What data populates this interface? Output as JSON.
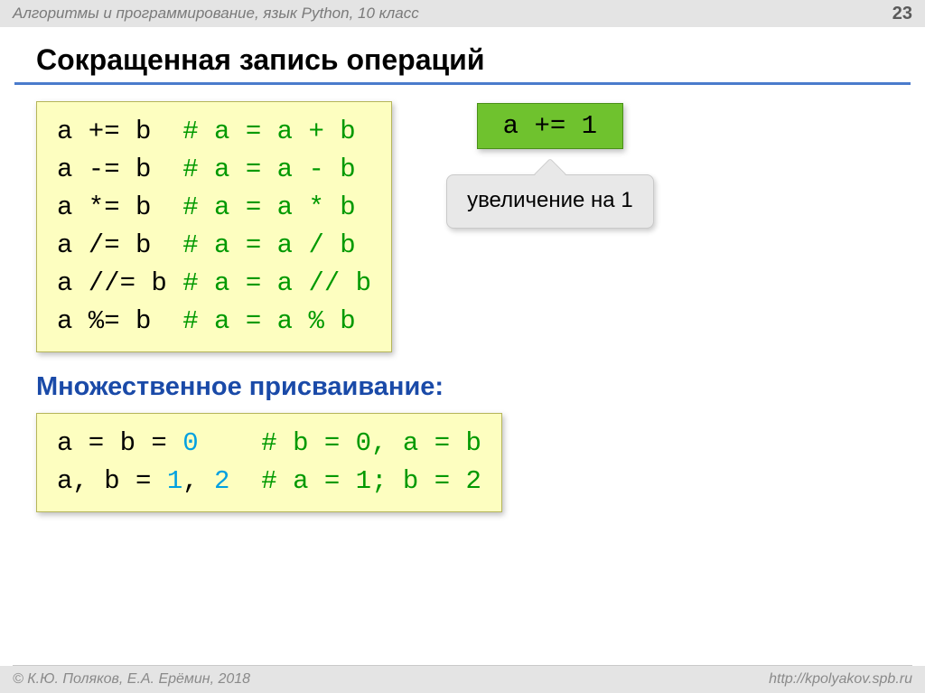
{
  "header": {
    "breadcrumb": "Алгоритмы и программирование, язык Python, 10 класс",
    "page": "23"
  },
  "title": "Сокращенная запись операций",
  "block1": {
    "lines": [
      {
        "code": "a += b  ",
        "comment": "# a = a + b"
      },
      {
        "code": "a -= b  ",
        "comment": "# a = a - b"
      },
      {
        "code": "a *= b  ",
        "comment": "# a = a * b"
      },
      {
        "code": "a /= b  ",
        "comment": "# a = a / b"
      },
      {
        "code": "a //= b ",
        "comment": "# a = a // b"
      },
      {
        "code": "a %= b  ",
        "comment": "# a = a % b"
      }
    ]
  },
  "highlight": {
    "code": "a += 1"
  },
  "callout": "увеличение на 1",
  "subhead": "Множественное присваивание:",
  "block2": {
    "lines": [
      {
        "pre": "a = b = ",
        "num": "0",
        "post": "    ",
        "comment": "# b = 0, a = b"
      },
      {
        "pre": "a, b = ",
        "num": "1",
        "mid": ", ",
        "num2": "2",
        "post": "  ",
        "comment": "# a = 1; b = 2"
      }
    ]
  },
  "footer": {
    "copyright": "© К.Ю. Поляков, Е.А. Ерёмин, 2018",
    "url": "http://kpolyakov.spb.ru"
  }
}
